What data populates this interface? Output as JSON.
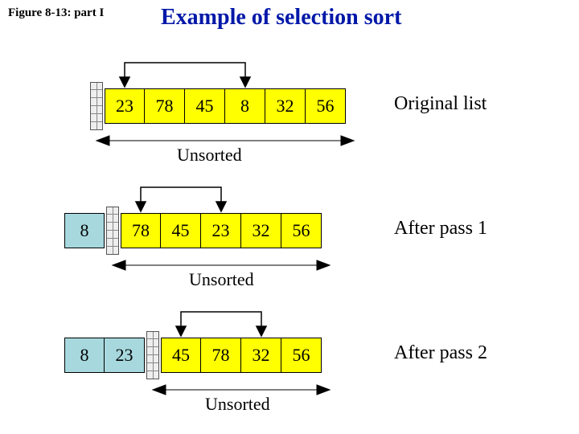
{
  "figure_label": "Figure 8-13: part I",
  "title": "Example of selection sort",
  "unsorted_label": "Unsorted",
  "stages": [
    {
      "label": "Original list",
      "sorted": [],
      "unsorted": [
        "23",
        "78",
        "45",
        "8",
        "32",
        "56"
      ],
      "swap_from_index": 0,
      "swap_to_index": 3
    },
    {
      "label": "After pass 1",
      "sorted": [
        "8"
      ],
      "unsorted": [
        "78",
        "45",
        "23",
        "32",
        "56"
      ],
      "swap_from_index": 0,
      "swap_to_index": 2
    },
    {
      "label": "After pass 2",
      "sorted": [
        "8",
        "23"
      ],
      "unsorted": [
        "45",
        "78",
        "32",
        "56"
      ],
      "swap_from_index": 0,
      "swap_to_index": 2
    }
  ]
}
